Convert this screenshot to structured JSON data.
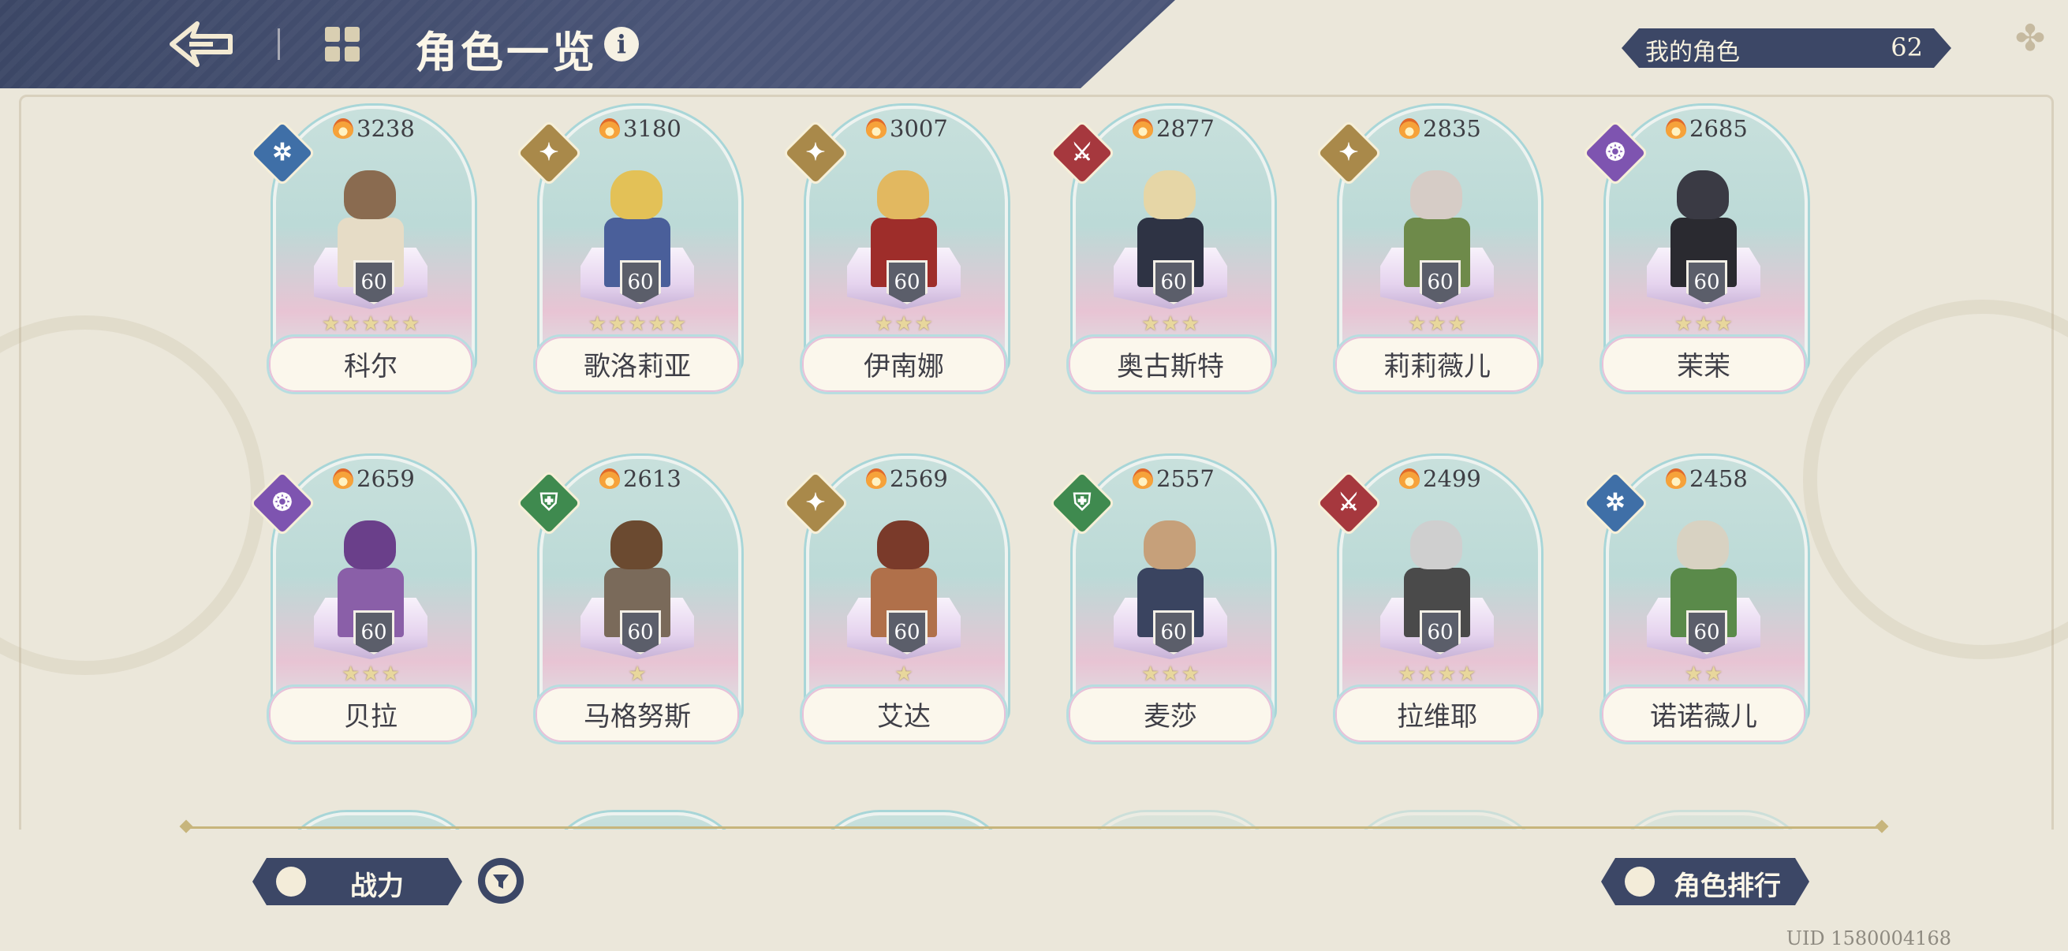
{
  "header": {
    "title": "角色一览",
    "info_icon": "i",
    "my_characters_label": "我的角色",
    "my_characters_count": "62"
  },
  "characters": [
    {
      "name": "科尔",
      "power": "3238",
      "level": "60",
      "stars": "★★★★★",
      "element": "wind-icon",
      "palette": [
        "#8a6b50",
        "#e6dcc6"
      ]
    },
    {
      "name": "歌洛莉亚",
      "power": "3180",
      "level": "60",
      "stars": "★★★★★",
      "element": "light-icon",
      "palette": [
        "#e3c157",
        "#4a5f9a"
      ]
    },
    {
      "name": "伊南娜",
      "power": "3007",
      "level": "60",
      "stars": "★★★",
      "element": "light-icon",
      "palette": [
        "#e2b860",
        "#9e2d2a"
      ]
    },
    {
      "name": "奥古斯特",
      "power": "2877",
      "level": "60",
      "stars": "★★★",
      "element": "fire-icon",
      "palette": [
        "#e6d6a6",
        "#2e3344"
      ]
    },
    {
      "name": "莉莉薇儿",
      "power": "2835",
      "level": "60",
      "stars": "★★★",
      "element": "light-icon",
      "palette": [
        "#d6ccc6",
        "#6e8a4a"
      ]
    },
    {
      "name": "茉茉",
      "power": "2685",
      "level": "60",
      "stars": "★★★",
      "element": "dark-icon",
      "palette": [
        "#3a3a44",
        "#2a2a30"
      ]
    },
    {
      "name": "贝拉",
      "power": "2659",
      "level": "60",
      "stars": "★★★",
      "element": "dark-icon",
      "palette": [
        "#6a3f8a",
        "#8a5fa8"
      ]
    },
    {
      "name": "马格努斯",
      "power": "2613",
      "level": "60",
      "stars": "★",
      "element": "earth-icon",
      "palette": [
        "#6b4a30",
        "#7a6a5a"
      ]
    },
    {
      "name": "艾达",
      "power": "2569",
      "level": "60",
      "stars": "★",
      "element": "light-icon",
      "palette": [
        "#7a3a2a",
        "#b0704a"
      ]
    },
    {
      "name": "麦莎",
      "power": "2557",
      "level": "60",
      "stars": "★★★",
      "element": "earth-icon",
      "palette": [
        "#c6a07a",
        "#3a4460"
      ]
    },
    {
      "name": "拉维耶",
      "power": "2499",
      "level": "60",
      "stars": "★★★★",
      "element": "fire-icon",
      "palette": [
        "#cfcfcf",
        "#4a4a4a"
      ]
    },
    {
      "name": "诺诺薇儿",
      "power": "2458",
      "level": "60",
      "stars": "★★",
      "element": "wind-icon",
      "palette": [
        "#d8d2c2",
        "#5a8a4a"
      ]
    }
  ],
  "element_glyphs": {
    "wind-icon": "✲",
    "light-icon": "✦",
    "fire-icon": "⚔",
    "dark-icon": "❂",
    "earth-icon": "⛨"
  },
  "bottom": {
    "sort_label": "战力",
    "ranking_label": "角色排行",
    "uid": "UID 1580004168"
  }
}
